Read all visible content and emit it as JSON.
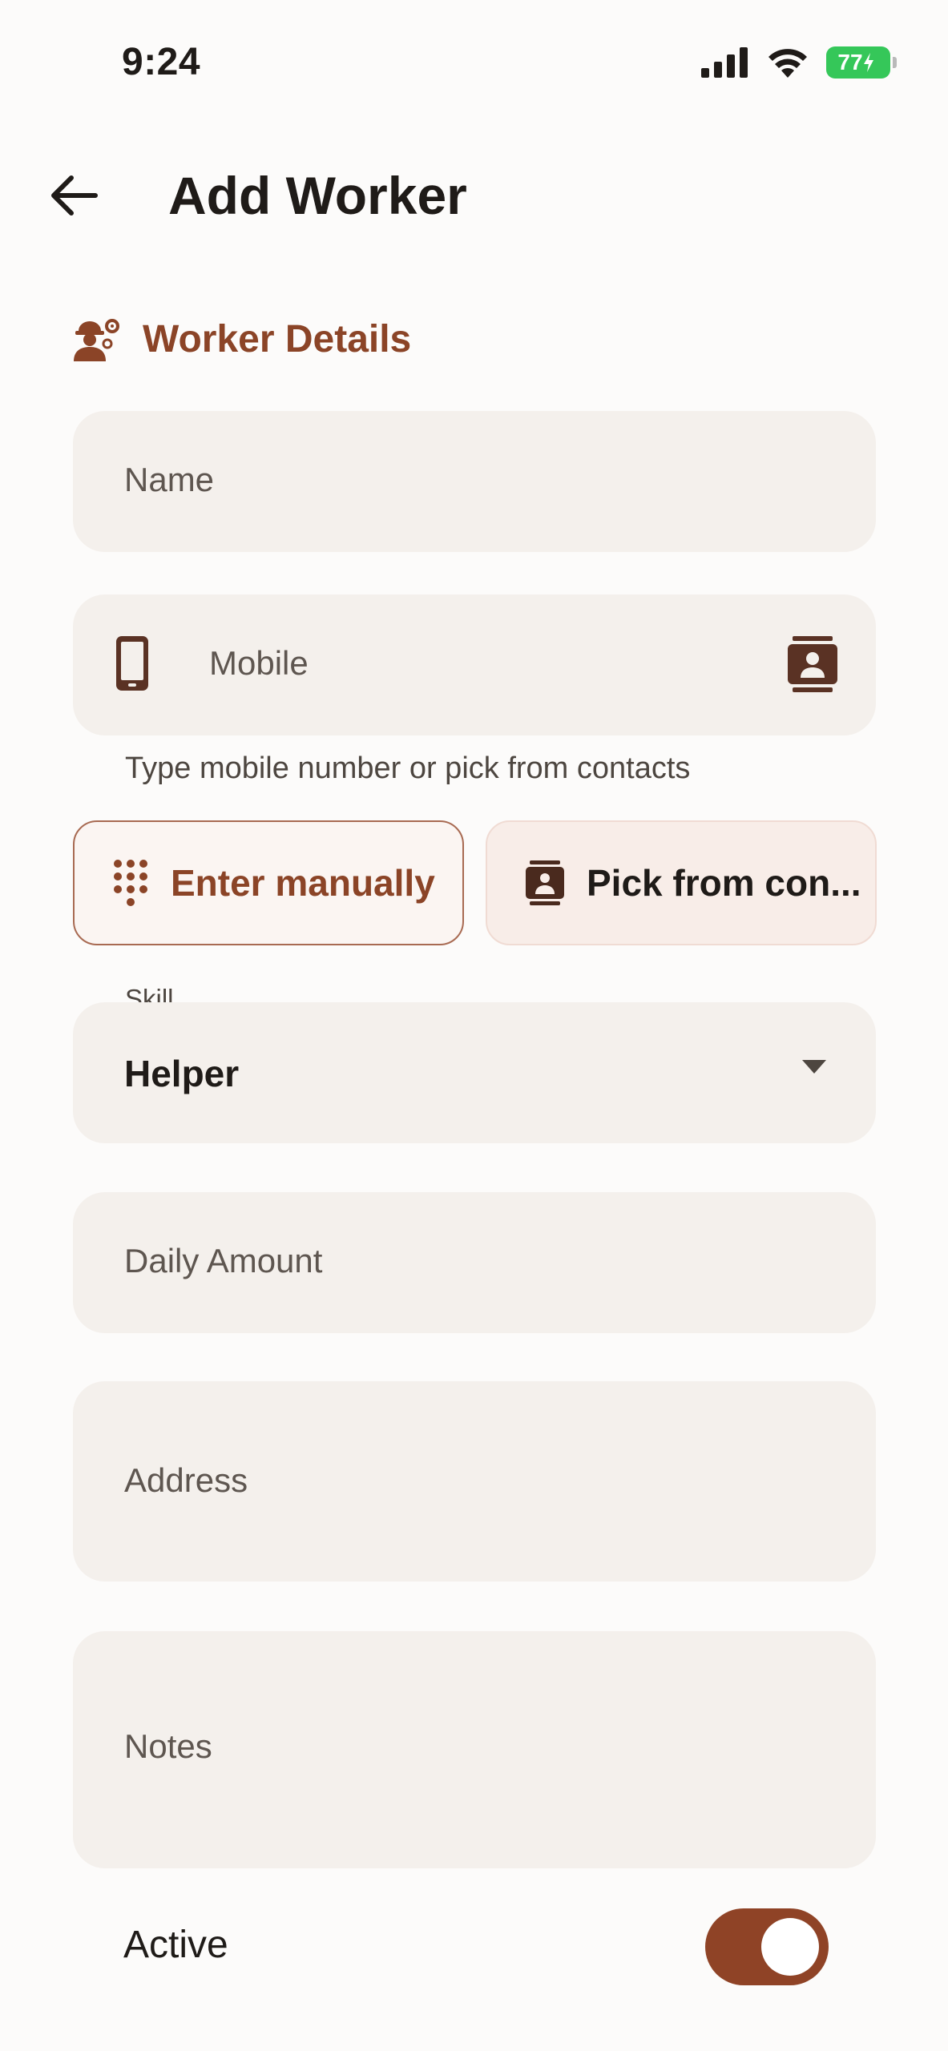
{
  "status_bar": {
    "time": "9:24",
    "battery": "77",
    "icons": [
      "signal-icon",
      "wifi-icon",
      "battery-icon"
    ]
  },
  "app_bar": {
    "title": "Add Worker",
    "back_icon": "arrow-left-icon"
  },
  "section": {
    "title": "Worker Details",
    "icon": "worker-settings-icon"
  },
  "form": {
    "name": {
      "placeholder": "Name",
      "value": ""
    },
    "mobile": {
      "placeholder": "Mobile",
      "value": "",
      "leading_icon": "phone-icon",
      "trailing_icon": "contacts-icon",
      "helper": "Type mobile number or pick from contacts"
    },
    "mobile_actions": {
      "manual": {
        "label": "Enter manually",
        "icon": "dialpad-icon"
      },
      "contacts": {
        "label": "Pick from con...",
        "icon": "contacts-icon"
      }
    },
    "skill": {
      "label": "Skill",
      "value": "Helper",
      "icon": "dropdown-arrow-icon"
    },
    "daily_amount": {
      "placeholder": "Daily Amount",
      "value": ""
    },
    "address": {
      "placeholder": "Address",
      "value": ""
    },
    "notes": {
      "placeholder": "Notes",
      "value": ""
    },
    "active": {
      "label": "Active",
      "on": true
    }
  },
  "colors": {
    "accent": "#8b4427",
    "field_background": "#f4f0ec",
    "toggle_on": "#8f4326",
    "battery": "#35c759"
  }
}
